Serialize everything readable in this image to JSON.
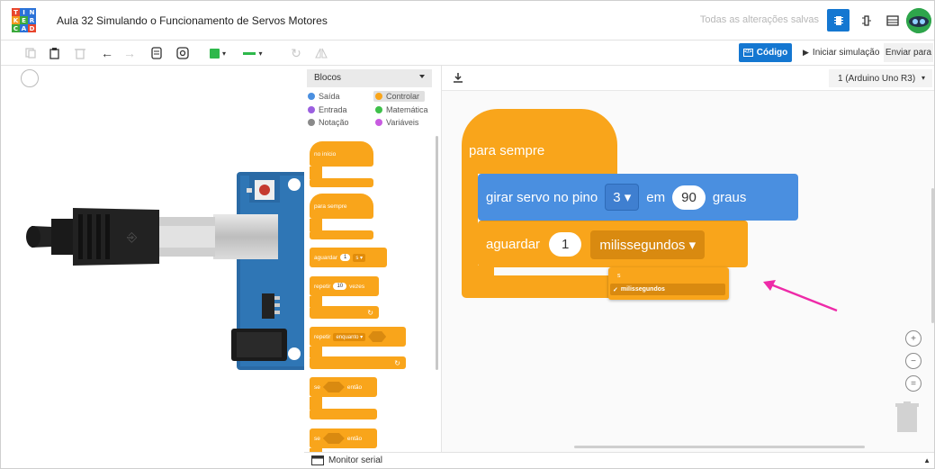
{
  "header": {
    "logo_letters": [
      "T",
      "I",
      "N",
      "K",
      "E",
      "R",
      "C",
      "A",
      "D"
    ],
    "doc_title": "Aula 32 Simulando o Funcionamento de Servos Motores",
    "saved_status": "Todas as alterações salvas"
  },
  "toolbar": {
    "code_label": "Código",
    "simulate_label": "Iniciar simulação",
    "send_label": "Enviar para",
    "color_swatch": "#2eb84b"
  },
  "palette": {
    "select_label": "Blocos",
    "categories": [
      {
        "label": "Saída",
        "color": "#4a8fe0"
      },
      {
        "label": "Controlar",
        "color": "#f9a51b"
      },
      {
        "label": "Entrada",
        "color": "#9b5fe0"
      },
      {
        "label": "Matemática",
        "color": "#3ec04a"
      },
      {
        "label": "Notação",
        "color": "#8a8a8a"
      },
      {
        "label": "Variáveis",
        "color": "#c85be0"
      }
    ],
    "blocks": {
      "on_start": "no início",
      "forever": "para sempre",
      "wait": "aguardar",
      "wait_value": "1",
      "wait_unit": "s ▾",
      "repeat": "repetir",
      "repeat_count": "10",
      "repeat_times": "vezes",
      "repeat_while": "repetir",
      "while_option": "enquanto ▾",
      "if": "se",
      "then": "então",
      "if2": "se",
      "then2": "então"
    }
  },
  "code": {
    "device": "1 (Arduino Uno R3)",
    "forever_label": "para sempre",
    "servo_label": "girar servo no pino",
    "servo_pin": "3 ▾",
    "em_label": "em",
    "angle": "90",
    "degrees_label": "graus",
    "wait_label": "aguardar",
    "wait_value": "1",
    "wait_unit": "milissegundos ▾",
    "dropdown_options": [
      "s",
      "milissegundos"
    ],
    "dropdown_selected_mark": "✓"
  },
  "footer": {
    "serial_monitor": "Monitor serial"
  },
  "colors": {
    "control": "#f9a51b",
    "output": "#4a8fe0",
    "accent": "#1477d1",
    "arrow": "#ee2aa8"
  }
}
